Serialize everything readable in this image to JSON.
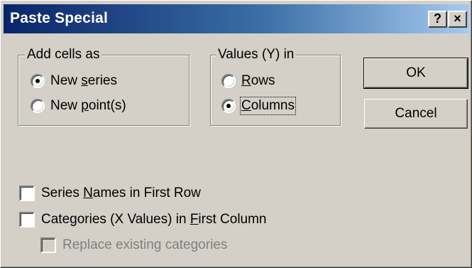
{
  "dialog": {
    "title": "Paste Special",
    "help_button": "?",
    "close_button": "×"
  },
  "add_cells": {
    "label": "Add cells as",
    "options": [
      {
        "label_pre": "New ",
        "label_u": "s",
        "label_post": "eries",
        "checked": true
      },
      {
        "label_pre": "New ",
        "label_u": "p",
        "label_post": "oint(s)",
        "checked": false
      }
    ]
  },
  "values_in": {
    "label": "Values (Y) in",
    "options": [
      {
        "label_pre": "",
        "label_u": "R",
        "label_post": "ows",
        "checked": false
      },
      {
        "label_pre": "",
        "label_u": "C",
        "label_post": "olumns",
        "checked": true
      }
    ]
  },
  "buttons": {
    "ok": "OK",
    "cancel": "Cancel"
  },
  "checkboxes": [
    {
      "label_pre": "Series ",
      "label_u": "N",
      "label_post": "ames in First Row",
      "checked": false,
      "enabled": true
    },
    {
      "label_pre": "Categories (X Values) in ",
      "label_u": "F",
      "label_post": "irst Column",
      "checked": false,
      "enabled": true
    },
    {
      "label_pre": "Replace existing categories",
      "label_u": "",
      "label_post": "",
      "checked": false,
      "enabled": false
    }
  ],
  "colors": {
    "face": "#d4d0c8",
    "title_start": "#0a246a",
    "title_end": "#a6caf0"
  }
}
